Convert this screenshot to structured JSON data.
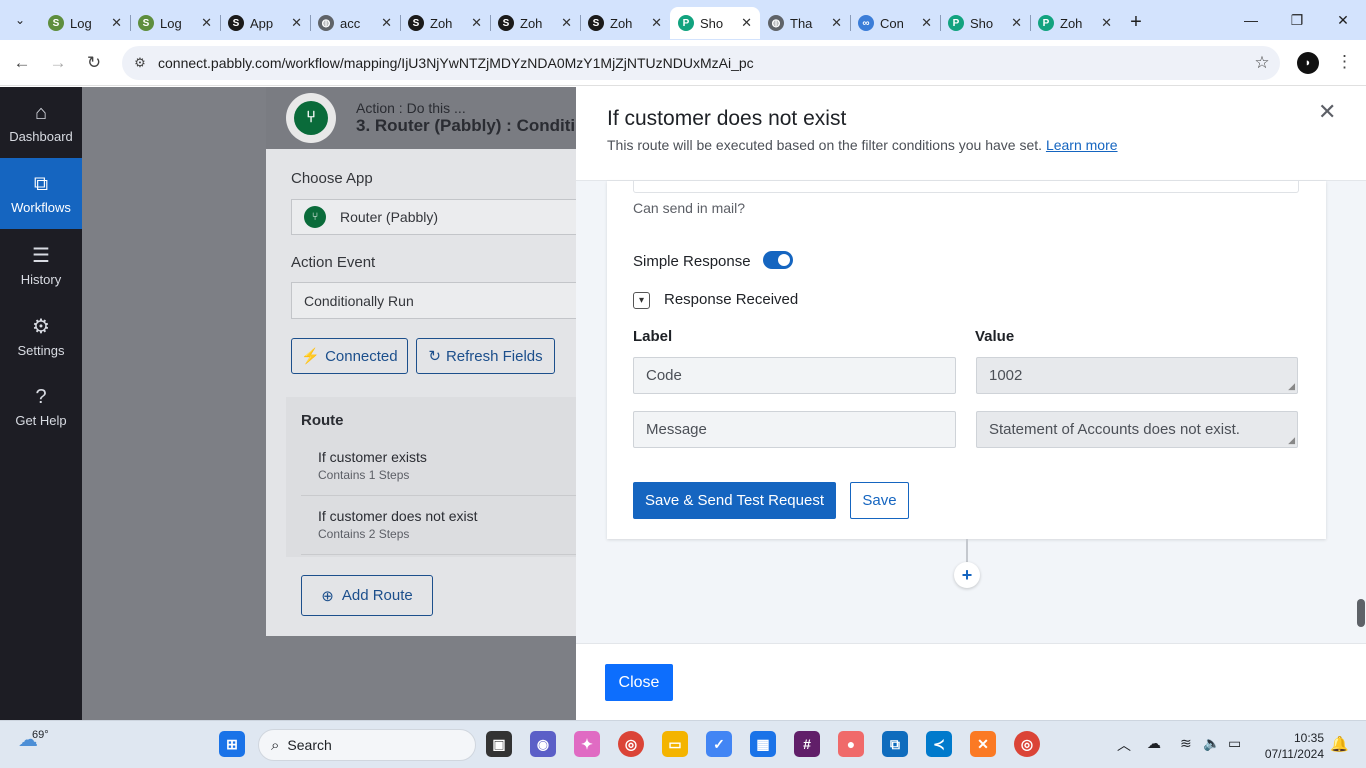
{
  "browser": {
    "tabs": [
      {
        "title": "Log",
        "icon": "shopify-icon",
        "color": "#5e8e3e",
        "active": false
      },
      {
        "title": "Log",
        "icon": "shopify-icon",
        "color": "#5e8e3e",
        "active": false
      },
      {
        "title": "App",
        "icon": "shopify-icon",
        "color": "#1a1a1a",
        "active": false
      },
      {
        "title": "acc",
        "icon": "globe-icon",
        "color": "#5f6368",
        "active": false
      },
      {
        "title": "Zoh",
        "icon": "shopify-icon",
        "color": "#1a1a1a",
        "active": false
      },
      {
        "title": "Zoh",
        "icon": "shopify-icon",
        "color": "#1a1a1a",
        "active": false
      },
      {
        "title": "Zoh",
        "icon": "shopify-icon",
        "color": "#1a1a1a",
        "active": false
      },
      {
        "title": "Sho",
        "icon": "pabbly-icon",
        "color": "#12a37f",
        "active": true
      },
      {
        "title": "Tha",
        "icon": "globe-icon",
        "color": "#5f6368",
        "active": false
      },
      {
        "title": "Con",
        "icon": "link-icon",
        "color": "#3b7dd8",
        "active": false
      },
      {
        "title": "Sho",
        "icon": "pabbly-icon",
        "color": "#12a37f",
        "active": false
      },
      {
        "title": "Zoh",
        "icon": "pabbly-icon",
        "color": "#12a37f",
        "active": false
      }
    ],
    "url": "connect.pabbly.com/workflow/mapping/IjU3NjYwNTZjMDYzNDA0MzY1MjZjNTUzNDUxMzAi_pc"
  },
  "sidebar": {
    "items": [
      {
        "label": "Dashboard",
        "icon": "home-icon",
        "active": false
      },
      {
        "label": "Workflows",
        "icon": "workflow-icon",
        "active": true
      },
      {
        "label": "History",
        "icon": "list-icon",
        "active": false
      },
      {
        "label": "Settings",
        "icon": "gear-icon",
        "active": false
      },
      {
        "label": "Get Help",
        "icon": "question-icon",
        "active": false
      }
    ]
  },
  "background": {
    "action_label": "Action : Do this ...",
    "step_title": "3. Router (Pabbly) : Conditi",
    "choose_app_label": "Choose App",
    "app_value": "Router (Pabbly)",
    "action_event_label": "Action Event",
    "action_event_value": "Conditionally Run",
    "connected_label": "Connected",
    "refresh_label": "Refresh Fields",
    "route_title": "Route",
    "routes": [
      {
        "name": "If customer exists",
        "steps": "Contains 1 Steps"
      },
      {
        "name": "If customer does not exist",
        "steps": "Contains 2 Steps"
      }
    ],
    "add_route_label": "Add Route"
  },
  "drawer": {
    "title": "If customer does not exist",
    "subtitle": "This route will be executed based on the filter conditions you have set.",
    "learn_more": "Learn more",
    "hint": "Can send in mail?",
    "simple_response_label": "Simple Response",
    "simple_response_on": true,
    "response_received_label": "Response Received",
    "label_header": "Label",
    "value_header": "Value",
    "rows": [
      {
        "label": "Code",
        "value": "1002"
      },
      {
        "label": "Message",
        "value": "Statement of Accounts does not exist."
      }
    ],
    "save_send_label": "Save & Send Test Request",
    "save_label": "Save",
    "close_label": "Close"
  },
  "taskbar": {
    "temperature": "69°",
    "search_placeholder": "Search",
    "time": "10:35",
    "date": "07/11/2024"
  },
  "colors": {
    "accent": "#1565c0",
    "sidebar_bg": "#1d1d24",
    "pabbly_green": "#0a6b3a"
  }
}
